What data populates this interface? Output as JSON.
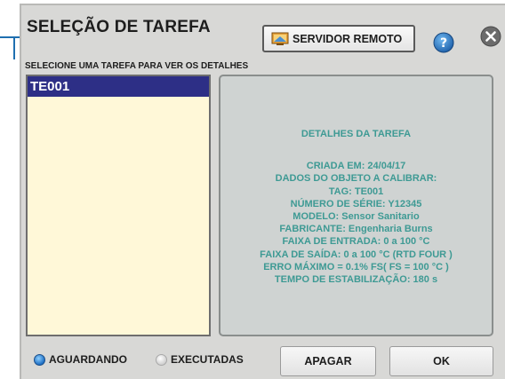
{
  "header": {
    "title": "SELEÇÃO DE TAREFA",
    "remote_button_label": "SERVIDOR REMOTO",
    "remote_icon": "remote-server-icon",
    "help_icon": "help-icon",
    "close_icon": "close-icon"
  },
  "subtitle": "SELECIONE UMA TAREFA PARA VER OS DETALHES",
  "task_list": {
    "items": [
      {
        "id": "TE001",
        "selected": true
      }
    ]
  },
  "details": {
    "title": "DETALHES DA TAREFA",
    "lines": [
      "CRIADA EM: 24/04/17",
      "DADOS DO OBJETO A CALIBRAR:",
      "TAG: TE001",
      "NÚMERO DE SÉRIE: Y12345",
      "MODELO: Sensor Sanitario",
      "FABRICANTE: Engenharia Burns",
      "FAIXA DE ENTRADA: 0 a 100 °C",
      "FAIXA DE SAÍDA: 0 a 100 °C (RTD FOUR )",
      "ERRO MÁXIMO = 0.1% FS( FS = 100 °C )",
      "TEMPO DE ESTABILIZAÇÃO: 180 s"
    ]
  },
  "filters": {
    "pending_label": "AGUARDANDO",
    "pending_selected": true,
    "executed_label": "EXECUTADAS",
    "executed_selected": false
  },
  "actions": {
    "delete_label": "APAGAR",
    "ok_label": "OK"
  },
  "colors": {
    "accent": "#2d2f86",
    "details_text": "#3e9a94",
    "list_background": "#fff8d8",
    "radio_active": "#1e6fc4"
  }
}
